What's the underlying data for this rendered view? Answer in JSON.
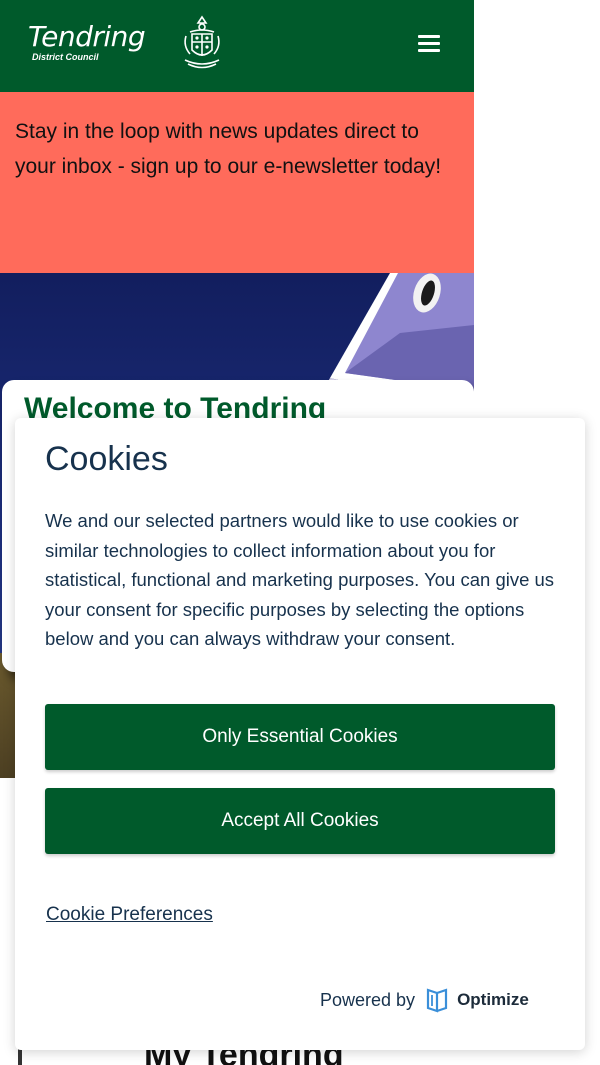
{
  "header": {
    "logo_name": "Tendring",
    "logo_sub": "District Council"
  },
  "banner": {
    "text": "Stay in the loop with news updates direct to your inbox - sign up to our e-newsletter today!"
  },
  "welcome": {
    "title": "Welcome to Tendring"
  },
  "my_tendring": {
    "title": "My Tendring"
  },
  "cookies": {
    "title": "Cookies",
    "description": "We and our selected partners would like to use cookies or similar technologies to collect information about you for statistical, functional and marketing purposes. You can give us your consent for specific purposes by selecting the options below and you can always withdraw your consent.",
    "essential_label": "Only Essential Cookies",
    "accept_label": "Accept All Cookies",
    "preferences_label": "Cookie Preferences",
    "powered_by": "Powered by",
    "brand": "Optimize"
  },
  "colors": {
    "brand_green": "#005a2b",
    "banner_coral": "#ff6b5b",
    "cookie_text": "#17324d",
    "optimize_blue": "#3a8fd9"
  }
}
